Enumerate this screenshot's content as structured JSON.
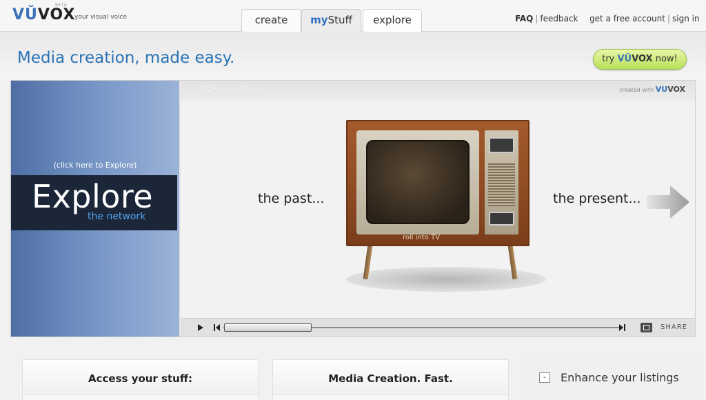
{
  "header": {
    "logo": {
      "accent": "VŬ",
      "rest": "VOX",
      "beta": "BETA"
    },
    "tagline": "your visual voice",
    "tabs": [
      {
        "label": "create"
      },
      {
        "prefix": "my",
        "label": "Stuff"
      },
      {
        "label": "explore"
      }
    ],
    "help_links": {
      "faq": "FAQ",
      "feedback": "feedback"
    },
    "account_links": {
      "signup": "get a free account",
      "signin": "sign in"
    }
  },
  "banner": {
    "headline": "Media creation, made easy.",
    "cta": {
      "prefix": "try",
      "brand_accent": "VŬ",
      "brand_rest": "VOX",
      "suffix": "now!"
    }
  },
  "explore_panel": {
    "hint": "(click here to Explore)",
    "title": "Explore",
    "subtitle": "the network"
  },
  "player": {
    "title": "A Sneak Peek...",
    "created_with": "created with",
    "brand_accent": "VU",
    "brand_rest": "VOX",
    "caption_left": "the past...",
    "caption_right": "the present...",
    "tv_label": "roll into TV",
    "share_label": "SHARE",
    "progress": 0.0
  },
  "cards": {
    "access": {
      "title": "Access your stuff:"
    },
    "media": {
      "title": "Media Creation. Fast."
    },
    "enhance": {
      "toggle": "-",
      "title": "Enhance your listings"
    }
  },
  "colors": {
    "brand_blue": "#2a73b5",
    "cta_green": "#b8e05a",
    "explore_dark": "#1b2638",
    "explore_accent": "#55a6ee"
  }
}
